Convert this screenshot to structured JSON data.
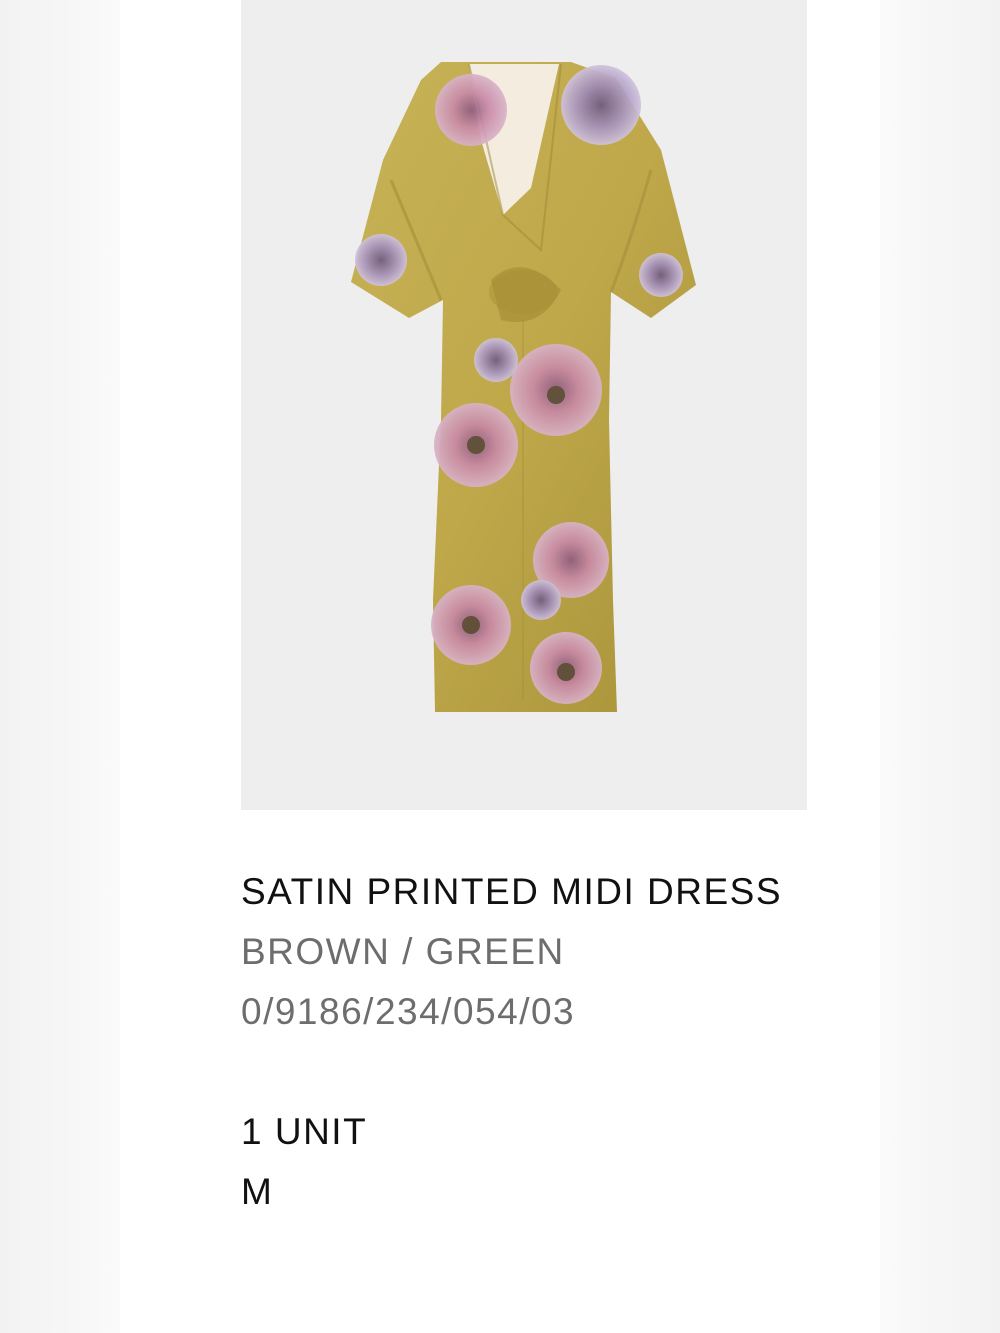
{
  "product": {
    "image_alt": "Satin printed midi dress product photo",
    "title": "SATIN PRINTED MIDI DRESS",
    "color": "BROWN / GREEN",
    "reference": "0/9186/234/054/03",
    "quantity": "1 UNIT",
    "size": "M"
  },
  "colors": {
    "page_bg": "#f4f4f4",
    "card_bg": "#ffffff",
    "image_bg": "#eeeeee",
    "dress_base": "#bfa84a",
    "flower_pink": "#c98aa6",
    "flower_lilac": "#a995c0",
    "text_primary": "#111111",
    "text_secondary": "#6d6d6d"
  }
}
